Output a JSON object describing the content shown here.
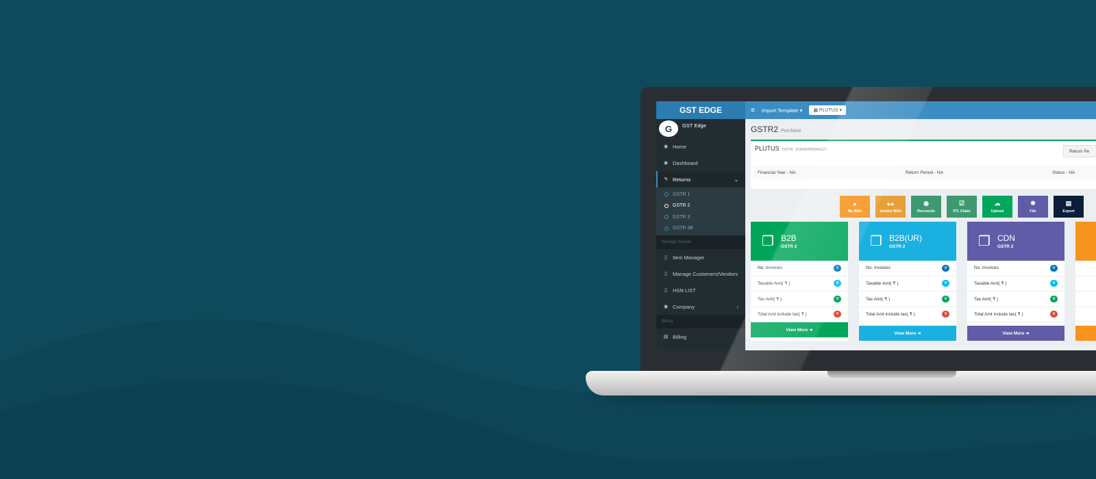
{
  "app": {
    "brand": "GST EDGE",
    "user_name": "GST Edge",
    "avatar_letter": "G"
  },
  "topbar": {
    "menu_icon": "hamburger-icon",
    "import_template": "Import Template ▾",
    "company_select": "▦ PLUTUS ▾"
  },
  "sidebar": {
    "items": [
      {
        "label": "Home",
        "icon": "dashboard-icon"
      },
      {
        "label": "Dashboard",
        "icon": "dashboard-icon"
      },
      {
        "label": "Returns",
        "icon": "reply-icon"
      }
    ],
    "returns_sub": [
      "GSTR 1",
      "GSTR 2",
      "GSTR 3",
      "GSTR 3B"
    ],
    "section_manage": "Manage Section",
    "manage_items": [
      {
        "label": "Item Manager"
      },
      {
        "label": "Manage Customers/Vendors"
      },
      {
        "label": "HSN LIST"
      },
      {
        "label": "Company"
      }
    ],
    "section_billing": "Billing",
    "billing_items": [
      {
        "label": "Billing"
      }
    ]
  },
  "content": {
    "title": "GSTR2",
    "subtitle": "Purchase",
    "company": "PLUTUS",
    "gstin": "GSTIN : 27AASFP6504G1ZY",
    "return_button": "Return Pe",
    "financial_year": "Financial Year - NA",
    "return_period": "Return Period - NA",
    "status": "Status - NA"
  },
  "actions": [
    {
      "label": "My Bills",
      "color": "#f7931e"
    },
    {
      "label": "Vendor Bills",
      "color": "#e8a13a"
    },
    {
      "label": "Reconcile",
      "color": "#3d9970"
    },
    {
      "label": "ITC Claim",
      "color": "#3d9970"
    },
    {
      "label": "Upload",
      "color": "#00a65a"
    },
    {
      "label": "File",
      "color": "#605ca8"
    },
    {
      "label": "Export",
      "color": "#0b1f3a"
    }
  ],
  "cards": [
    {
      "title": "B2B",
      "sub": "GSTR 2",
      "color": "#00a65a",
      "foot": "View More ➜"
    },
    {
      "title": "B2B(UR)",
      "sub": "GSTR 2",
      "color": "#1ab0e0",
      "foot": "View More ➜"
    },
    {
      "title": "CDN",
      "sub": "GSTR 2",
      "color": "#605ca8",
      "foot": "View More ➜"
    }
  ],
  "card_rows": [
    "No. Invoices",
    "Taxable Amt( ₹ )",
    "Tax Amt( ₹ )",
    "Total Amt include tax( ₹ )"
  ],
  "card_values": [
    "0",
    "0",
    "0",
    "0"
  ],
  "pill_colors": [
    "#0073b7",
    "#00c0ef",
    "#00a65a",
    "#dd4b39"
  ]
}
